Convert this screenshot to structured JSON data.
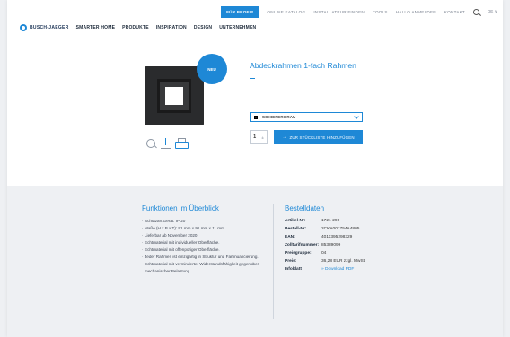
{
  "topbar": {
    "items": [
      {
        "label": "FÜR PROFIS",
        "active": true
      },
      {
        "label": "ONLINE KATALOG",
        "active": false
      },
      {
        "label": "INSTALLATEUR FINDEN",
        "active": false
      },
      {
        "label": "TOOLS",
        "active": false
      },
      {
        "label": "HALLO ANMELDEN",
        "active": false
      },
      {
        "label": "KONTAKT",
        "active": false
      }
    ],
    "search_icon": "search-icon",
    "language": "DE ∨"
  },
  "nav": {
    "brand": "BUSCH-JAEGER",
    "items": [
      "SMARTER HOME",
      "PRODUKTE",
      "INSPIRATION",
      "DESIGN",
      "UNTERNEHMEN"
    ]
  },
  "product": {
    "badge": "NEU",
    "title": "Abdeckrahmen 1-fach Rahmen",
    "title_dash": "—",
    "color_option": "SCHIEFERGRAU",
    "quantity": "1",
    "quantity_step": "±",
    "cart_button": "ZUR STÜCKLISTE HINZUFÜGEN",
    "cart_arrow": "→",
    "tool_icons": [
      "zoom-icon",
      "download-icon",
      "print-icon"
    ]
  },
  "features": {
    "title": "Funktionen im Überblick",
    "items": [
      "Schutzart Gerät: IP 20",
      "Maße (H x B x T): 91 mm x 91 mm x 11 mm",
      "Lieferbar ab November 2020",
      "Echtmaterial mit individueller Oberfläche.",
      "Echtmaterial mit offenporiger Oberfläche.",
      "Jeder Rahmen ist einzigartig in Struktur und Farbnuancierung.",
      "Echtmaterial mit verminderter Widerstandsfähigkeit gegenüber mechanischer Belastung."
    ]
  },
  "order": {
    "title": "Bestelldaten",
    "rows": [
      {
        "k": "Artikel-Nr:",
        "v": "1721-290"
      },
      {
        "k": "Bestell-Nr:",
        "v": "2CKA001754A4805"
      },
      {
        "k": "EAN:",
        "v": "4011395298329"
      },
      {
        "k": "Zolltarifnummer:",
        "v": "85389099"
      },
      {
        "k": "Preisgruppe:",
        "v": "04"
      },
      {
        "k": "Preis:",
        "v": "36,28 EUR zzgl. MwSt."
      },
      {
        "k": "Infoblatt",
        "v": "» Download PDF"
      }
    ]
  }
}
